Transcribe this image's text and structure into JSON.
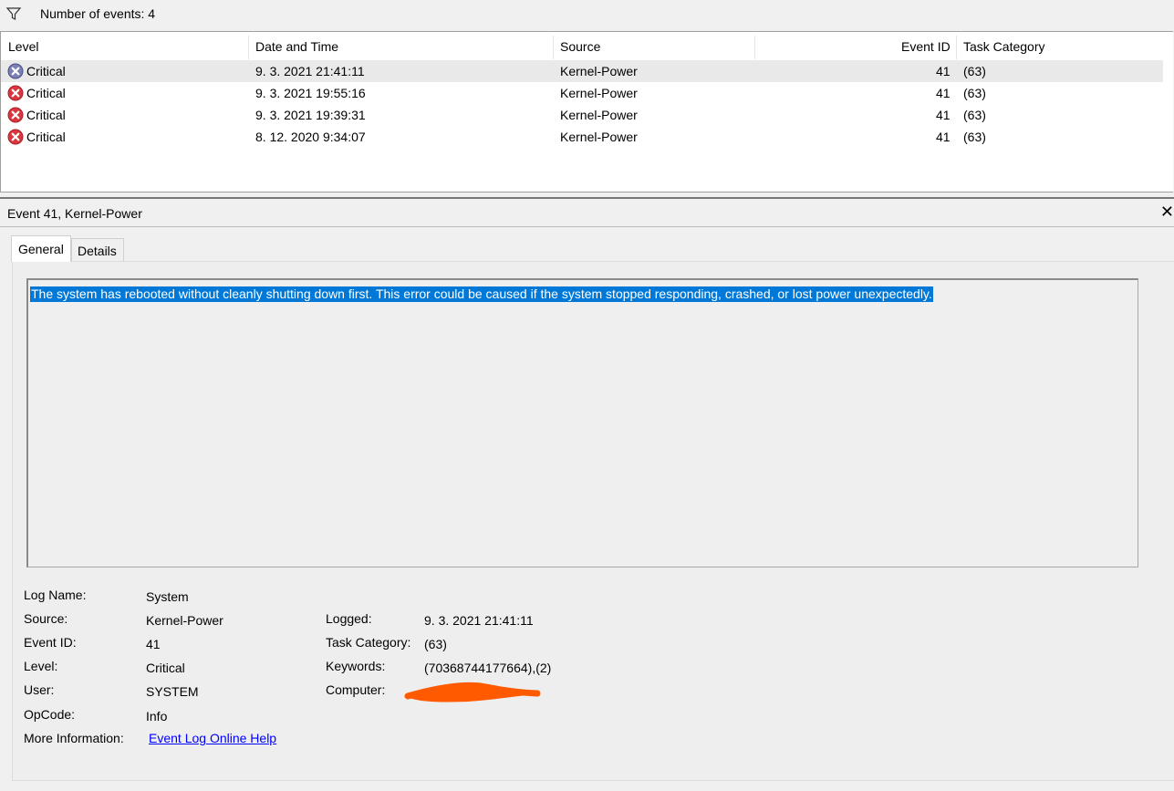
{
  "filter": {
    "icon": "filter-icon",
    "text": "Number of events: 4"
  },
  "columns": [
    "Level",
    "Date and Time",
    "Source",
    "Event ID",
    "Task Category"
  ],
  "events": [
    {
      "level": "Critical",
      "datetime": "9. 3. 2021 21:41:11",
      "source": "Kernel-Power",
      "event_id": "41",
      "task_category": "(63)"
    },
    {
      "level": "Critical",
      "datetime": "9. 3. 2021 19:55:16",
      "source": "Kernel-Power",
      "event_id": "41",
      "task_category": "(63)"
    },
    {
      "level": "Critical",
      "datetime": "9. 3. 2021 19:39:31",
      "source": "Kernel-Power",
      "event_id": "41",
      "task_category": "(63)"
    },
    {
      "level": "Critical",
      "datetime": "8. 12. 2020 9:34:07",
      "source": "Kernel-Power",
      "event_id": "41",
      "task_category": "(63)"
    }
  ],
  "detail": {
    "title": "Event 41, Kernel-Power",
    "close": "✕",
    "tabs": [
      "General",
      "Details"
    ],
    "message": "The system has rebooted without cleanly shutting down first. This error could be caused if the system stopped responding, crashed, or lost power unexpectedly.",
    "fields": {
      "log_name_label": "Log Name:",
      "log_name": "System",
      "source_label": "Source:",
      "source": "Kernel-Power",
      "event_id_label": "Event ID:",
      "event_id": "41",
      "level_label": "Level:",
      "level": "Critical",
      "user_label": "User:",
      "user": "SYSTEM",
      "opcode_label": "OpCode:",
      "opcode": "Info",
      "more_info_label": "More Information:",
      "more_info_link": "Event Log Online Help",
      "logged_label": "Logged:",
      "logged": "9. 3. 2021 21:41:11",
      "task_category_label": "Task Category:",
      "task_category": "(63)",
      "keywords_label": "Keywords:",
      "keywords": "(70368744177664),(2)",
      "computer_label": "Computer:"
    }
  },
  "colors": {
    "selection": "#0078d7",
    "critical": "#d9363e",
    "redaction": "#ff5a00",
    "link": "#0000ff"
  }
}
